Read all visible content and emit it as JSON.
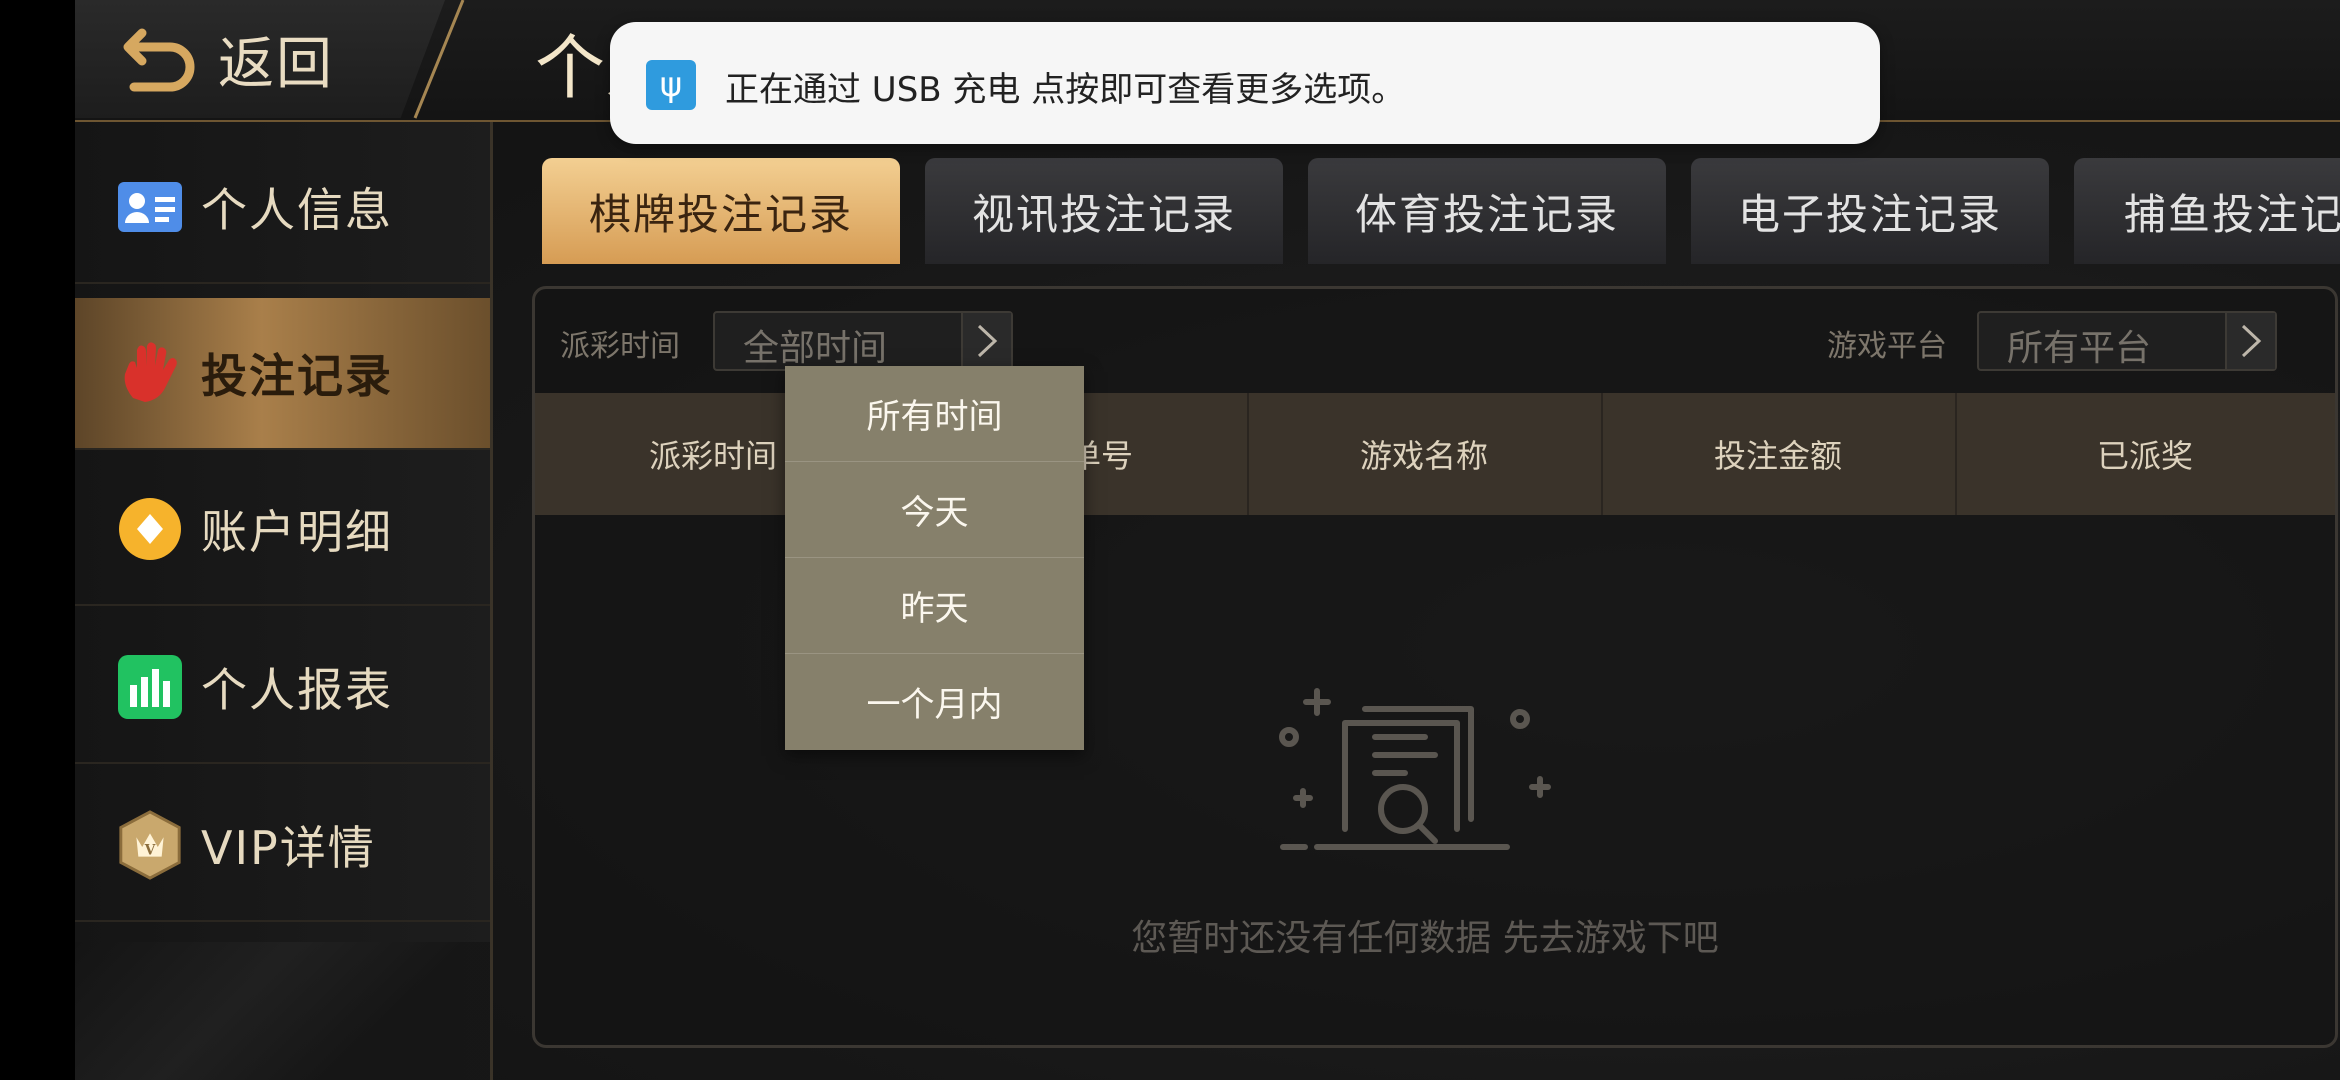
{
  "header": {
    "back_label": "返回",
    "title": "个人中心"
  },
  "sidebar": {
    "items": [
      {
        "label": "个人信息",
        "icon": "id-card-icon"
      },
      {
        "label": "投注记录",
        "icon": "hand-icon",
        "active": true
      },
      {
        "label": "账户明细",
        "icon": "diamond-coin-icon"
      },
      {
        "label": "个人报表",
        "icon": "bar-chart-icon"
      },
      {
        "label": "VIP详情",
        "icon": "vip-crown-icon"
      }
    ]
  },
  "tabs": [
    {
      "label": "棋牌投注记录",
      "active": true
    },
    {
      "label": "视讯投注记录"
    },
    {
      "label": "体育投注记录"
    },
    {
      "label": "电子投注记录"
    },
    {
      "label": "捕鱼投注记录"
    }
  ],
  "filters": {
    "time_label": "派彩时间",
    "time_value": "全部时间",
    "platform_label": "游戏平台",
    "platform_value": "所有平台"
  },
  "table": {
    "columns": [
      "派彩时间",
      "投注单号",
      "游戏名称",
      "投注金额",
      "已派奖"
    ]
  },
  "dropdown": {
    "options": [
      "所有时间",
      "今天",
      "昨天",
      "一个月内"
    ]
  },
  "empty_state": {
    "text": "您暂时还没有任何数据 先去游戏下吧"
  },
  "notification": {
    "text": "正在通过 USB 充电  点按即可查看更多选项。",
    "icon": "usb-icon"
  },
  "colors": {
    "accent_gold": "#d69c54",
    "active_tab_text": "#3a2410",
    "dropdown_bg": "#86806b",
    "usb_blue": "#2f9bde"
  }
}
